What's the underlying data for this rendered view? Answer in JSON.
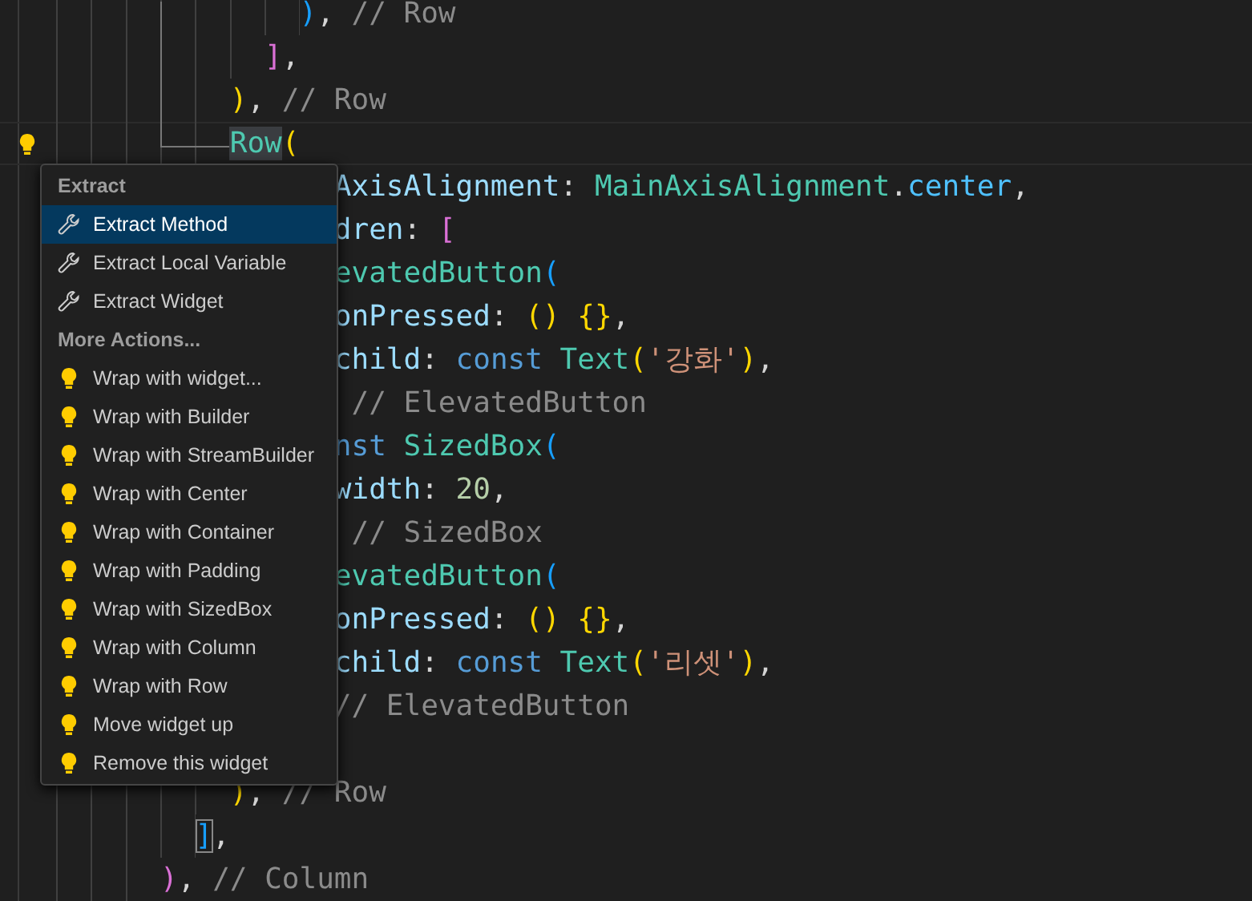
{
  "editor": {
    "lines": [
      {
        "lightbulb": false,
        "current": false,
        "tokens": [
          {
            "text": "              )",
            "kind": "bracket_blue"
          },
          {
            "text": ", ",
            "kind": "punct"
          },
          {
            "text": "// Row",
            "kind": "comment"
          }
        ]
      },
      {
        "lightbulb": false,
        "current": false,
        "tokens": [
          {
            "text": "            ]",
            "kind": "bracket_magenta"
          },
          {
            "text": ",",
            "kind": "punct"
          }
        ]
      },
      {
        "lightbulb": false,
        "current": false,
        "tokens": [
          {
            "text": "          )",
            "kind": "bracket_yellow"
          },
          {
            "text": ", ",
            "kind": "punct"
          },
          {
            "text": "// Row",
            "kind": "comment"
          }
        ]
      },
      {
        "lightbulb": true,
        "current": true,
        "tokens": [
          {
            "text": "          Row",
            "kind": "class_match"
          },
          {
            "text": "(",
            "kind": "bracket_yellow"
          }
        ]
      },
      {
        "lightbulb": false,
        "current": false,
        "tokens": [
          {
            "text": "                AxisAlignment",
            "kind": "property"
          },
          {
            "text": ": ",
            "kind": "punct"
          },
          {
            "text": "MainAxisAlignment",
            "kind": "class"
          },
          {
            "text": ".",
            "kind": "punct"
          },
          {
            "text": "center",
            "kind": "member"
          },
          {
            "text": ",",
            "kind": "punct"
          }
        ]
      },
      {
        "lightbulb": false,
        "current": false,
        "tokens": [
          {
            "text": "                dren",
            "kind": "property"
          },
          {
            "text": ": ",
            "kind": "punct"
          },
          {
            "text": "[",
            "kind": "bracket_magenta"
          }
        ]
      },
      {
        "lightbulb": false,
        "current": false,
        "tokens": [
          {
            "text": "                evatedButton",
            "kind": "class"
          },
          {
            "text": "(",
            "kind": "bracket_blue"
          }
        ]
      },
      {
        "lightbulb": false,
        "current": false,
        "tokens": [
          {
            "text": "                onPressed",
            "kind": "property"
          },
          {
            "text": ": ",
            "kind": "punct"
          },
          {
            "text": "() {}",
            "kind": "bracket_yellow"
          },
          {
            "text": ",",
            "kind": "punct"
          }
        ]
      },
      {
        "lightbulb": false,
        "current": false,
        "tokens": [
          {
            "text": "                child",
            "kind": "property"
          },
          {
            "text": ": ",
            "kind": "punct"
          },
          {
            "text": "const ",
            "kind": "keyword"
          },
          {
            "text": "Text",
            "kind": "class"
          },
          {
            "text": "(",
            "kind": "bracket_yellow"
          },
          {
            "text": "'강화'",
            "kind": "string"
          },
          {
            "text": ")",
            "kind": "bracket_yellow"
          },
          {
            "text": ",",
            "kind": "punct"
          }
        ]
      },
      {
        "lightbulb": false,
        "current": false,
        "tokens": [
          {
            "text": "                 // ElevatedButton",
            "kind": "comment"
          }
        ]
      },
      {
        "lightbulb": false,
        "current": false,
        "tokens": [
          {
            "text": "                nst ",
            "kind": "keyword"
          },
          {
            "text": "SizedBox",
            "kind": "class"
          },
          {
            "text": "(",
            "kind": "bracket_blue"
          }
        ]
      },
      {
        "lightbulb": false,
        "current": false,
        "tokens": [
          {
            "text": "                width",
            "kind": "property"
          },
          {
            "text": ": ",
            "kind": "punct"
          },
          {
            "text": "20",
            "kind": "number"
          },
          {
            "text": ",",
            "kind": "punct"
          }
        ]
      },
      {
        "lightbulb": false,
        "current": false,
        "tokens": [
          {
            "text": "                 // SizedBox",
            "kind": "comment"
          }
        ]
      },
      {
        "lightbulb": false,
        "current": false,
        "tokens": [
          {
            "text": "                evatedButton",
            "kind": "class"
          },
          {
            "text": "(",
            "kind": "bracket_blue"
          }
        ]
      },
      {
        "lightbulb": false,
        "current": false,
        "tokens": [
          {
            "text": "                onPressed",
            "kind": "property"
          },
          {
            "text": ": ",
            "kind": "punct"
          },
          {
            "text": "() {}",
            "kind": "bracket_yellow"
          },
          {
            "text": ",",
            "kind": "punct"
          }
        ]
      },
      {
        "lightbulb": false,
        "current": false,
        "tokens": [
          {
            "text": "                child",
            "kind": "property"
          },
          {
            "text": ": ",
            "kind": "punct"
          },
          {
            "text": "const ",
            "kind": "keyword"
          },
          {
            "text": "Text",
            "kind": "class"
          },
          {
            "text": "(",
            "kind": "bracket_yellow"
          },
          {
            "text": "'리셋'",
            "kind": "string"
          },
          {
            "text": ")",
            "kind": "bracket_yellow"
          },
          {
            "text": ",",
            "kind": "punct"
          }
        ]
      },
      {
        "lightbulb": false,
        "current": false,
        "tokens": [
          {
            "text": "                // ElevatedButton",
            "kind": "comment"
          }
        ]
      },
      {
        "lightbulb": false,
        "current": false
      },
      {
        "lightbulb": false,
        "current": false,
        "tokens": [
          {
            "text": "          )",
            "kind": "bracket_yellow"
          },
          {
            "text": ", ",
            "kind": "punct"
          },
          {
            "text": "// Row",
            "kind": "comment"
          }
        ]
      },
      {
        "lightbulb": false,
        "current": false,
        "tokens": [
          {
            "text": "        ]",
            "kind": "bracket_match"
          },
          {
            "text": ",",
            "kind": "punct"
          }
        ]
      },
      {
        "lightbulb": false,
        "current": false,
        "tokens": [
          {
            "text": "      )",
            "kind": "bracket_magenta"
          },
          {
            "text": ", ",
            "kind": "punct"
          },
          {
            "text": "// Column",
            "kind": "comment"
          }
        ]
      }
    ]
  },
  "code_actions": {
    "groups": [
      {
        "title": "Extract",
        "items": [
          {
            "label": "Extract Method",
            "kind": "refactor",
            "selected": true
          },
          {
            "label": "Extract Local Variable",
            "kind": "refactor",
            "selected": false
          },
          {
            "label": "Extract Widget",
            "kind": "refactor",
            "selected": false
          }
        ]
      },
      {
        "title": "More Actions...",
        "items": [
          {
            "label": "Wrap with widget...",
            "kind": "quickfix",
            "selected": false
          },
          {
            "label": "Wrap with Builder",
            "kind": "quickfix",
            "selected": false
          },
          {
            "label": "Wrap with StreamBuilder",
            "kind": "quickfix",
            "selected": false
          },
          {
            "label": "Wrap with Center",
            "kind": "quickfix",
            "selected": false
          },
          {
            "label": "Wrap with Container",
            "kind": "quickfix",
            "selected": false
          },
          {
            "label": "Wrap with Padding",
            "kind": "quickfix",
            "selected": false
          },
          {
            "label": "Wrap with SizedBox",
            "kind": "quickfix",
            "selected": false
          },
          {
            "label": "Wrap with Column",
            "kind": "quickfix",
            "selected": false
          },
          {
            "label": "Wrap with Row",
            "kind": "quickfix",
            "selected": false
          },
          {
            "label": "Move widget up",
            "kind": "quickfix",
            "selected": false
          },
          {
            "label": "Remove this widget",
            "kind": "quickfix",
            "selected": false
          }
        ]
      }
    ]
  }
}
